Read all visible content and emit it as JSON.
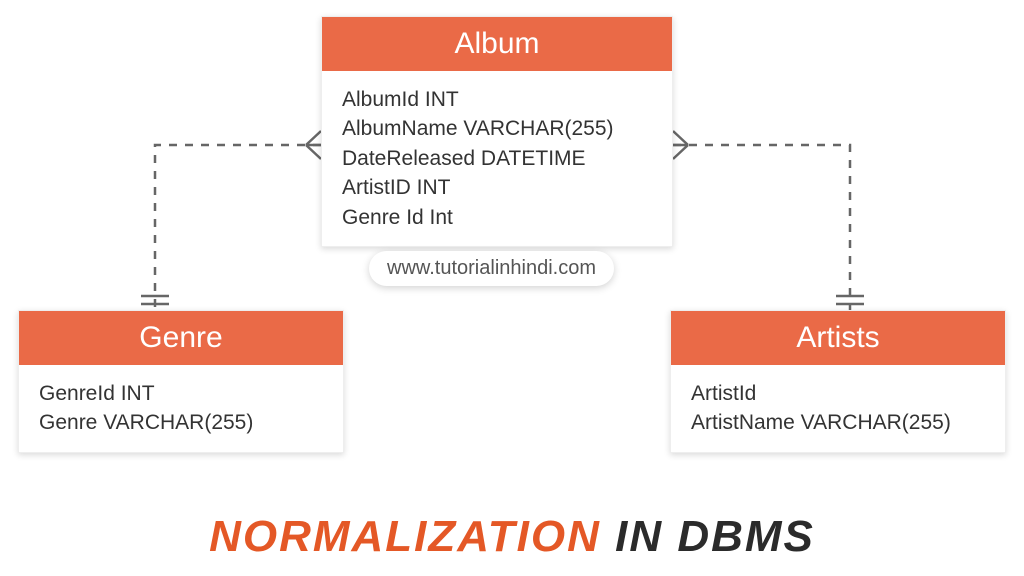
{
  "entities": {
    "album": {
      "title": "Album",
      "attrs": [
        "AlbumId INT",
        "AlbumName VARCHAR(255)",
        "DateReleased DATETIME",
        "ArtistID INT",
        "Genre Id Int"
      ]
    },
    "genre": {
      "title": "Genre",
      "attrs": [
        "GenreId INT",
        "Genre VARCHAR(255)"
      ]
    },
    "artists": {
      "title": "Artists",
      "attrs": [
        "ArtistId",
        "ArtistName VARCHAR(255)"
      ]
    }
  },
  "watermark": "www.tutorialinhindi.com",
  "caption_word1": "NORMALIZATION",
  "caption_word2": " IN DBMS",
  "colors": {
    "accent": "#ea6a47",
    "caption_accent": "#e45826",
    "text_dark": "#2b2b2b"
  }
}
